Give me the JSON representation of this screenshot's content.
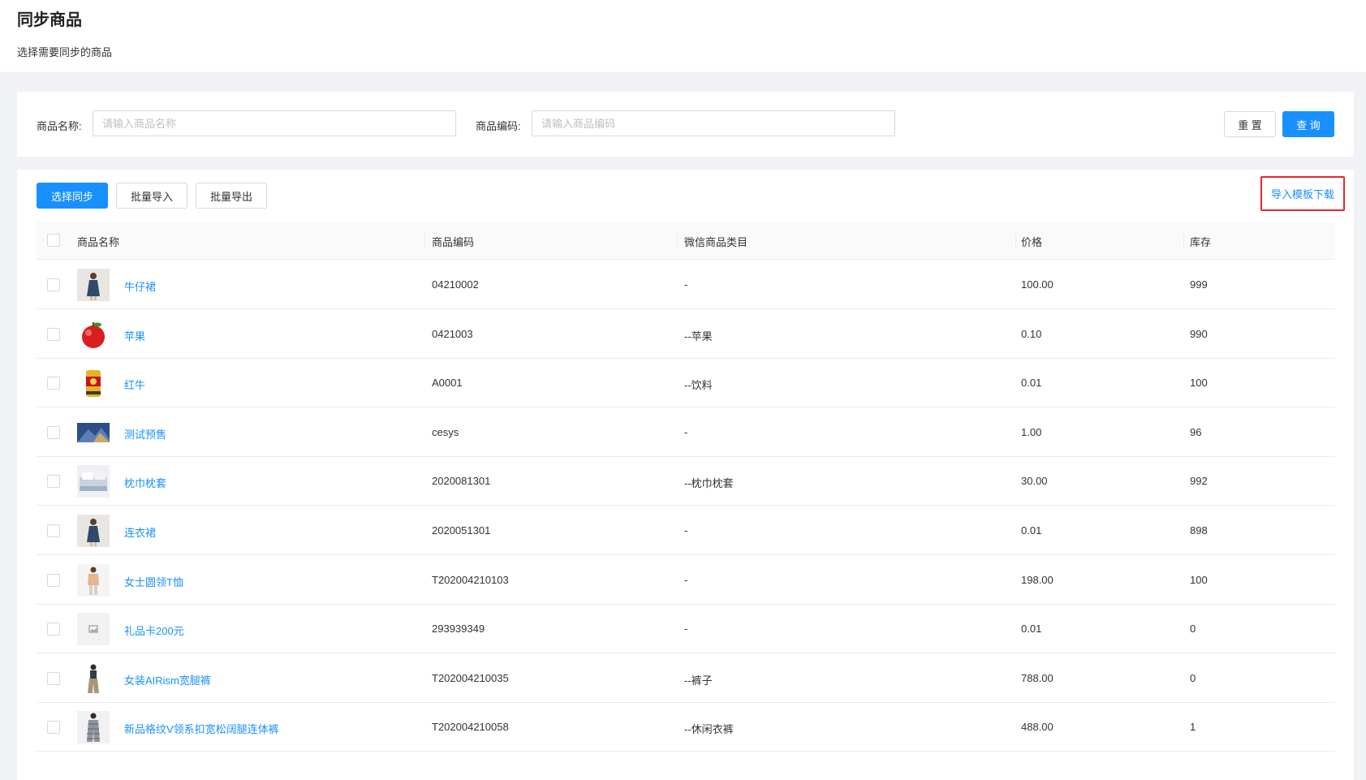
{
  "header": {
    "title": "同步商品",
    "subtitle": "选择需要同步的商品"
  },
  "filters": {
    "name_label": "商品名称:",
    "name_placeholder": "请输入商品名称",
    "name_value": "",
    "code_label": "商品编码:",
    "code_placeholder": "请输入商品编码",
    "code_value": "",
    "reset_label": "重 置",
    "query_label": "查 询"
  },
  "toolbar": {
    "select_sync_label": "选择同步",
    "batch_import_label": "批量导入",
    "batch_export_label": "批量导出",
    "template_download_label": "导入模板下载"
  },
  "table": {
    "columns": {
      "name": "商品名称",
      "code": "商品编码",
      "category": "微信商品类目",
      "price": "价格",
      "stock": "库存"
    },
    "rows": [
      {
        "name": "牛仔裙",
        "code": "04210002",
        "category": "-",
        "price": "100.00",
        "stock": "999",
        "thumb": "dress-photo"
      },
      {
        "name": "苹果",
        "code": "0421003",
        "category": "--苹果",
        "price": "0.10",
        "stock": "990",
        "thumb": "apple-photo"
      },
      {
        "name": "红牛",
        "code": "A0001",
        "category": "--饮料",
        "price": "0.01",
        "stock": "100",
        "thumb": "can-photo"
      },
      {
        "name": "测试预售",
        "code": "cesys",
        "category": "-",
        "price": "1.00",
        "stock": "96",
        "thumb": "landscape-photo"
      },
      {
        "name": "枕巾枕套",
        "code": "2020081301",
        "category": "--枕巾枕套",
        "price": "30.00",
        "stock": "992",
        "thumb": "bedding-photo"
      },
      {
        "name": "连衣裙",
        "code": "2020051301",
        "category": "-",
        "price": "0.01",
        "stock": "898",
        "thumb": "dress-photo"
      },
      {
        "name": "女士圆领T恤",
        "code": "T202004210103",
        "category": "-",
        "price": "198.00",
        "stock": "100",
        "thumb": "tshirt-photo"
      },
      {
        "name": "礼品卡200元",
        "code": "293939349",
        "category": "-",
        "price": "0.01",
        "stock": "0",
        "thumb": "placeholder-image"
      },
      {
        "name": "女装AIRism宽腿裤",
        "code": "T202004210035",
        "category": "--裤子",
        "price": "788.00",
        "stock": "0",
        "thumb": "pants-photo"
      },
      {
        "name": "新品格纹V领系扣宽松阔腿连体裤",
        "code": "T202004210058",
        "category": "--休闲衣裤",
        "price": "488.00",
        "stock": "1",
        "thumb": "jumpsuit-photo"
      }
    ]
  },
  "colors": {
    "primary": "#1890ff",
    "highlight_border": "#e8262b"
  }
}
